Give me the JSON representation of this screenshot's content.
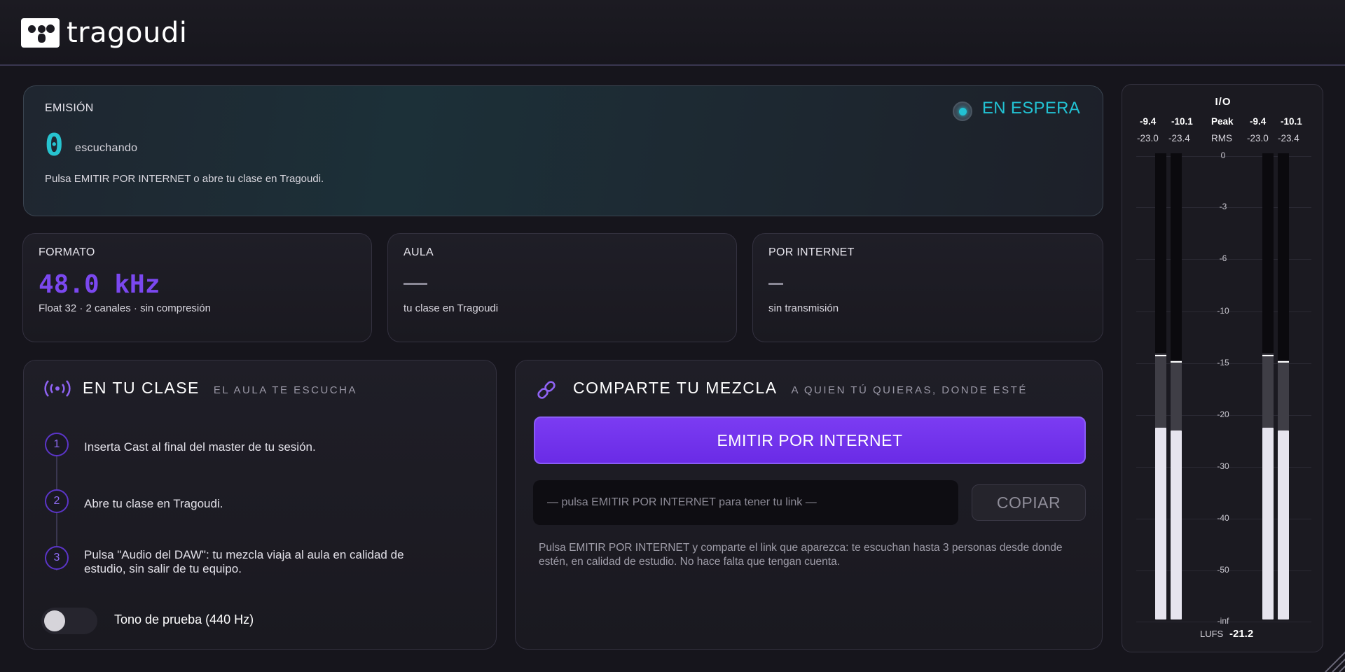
{
  "app": {
    "brand": "tragoudi"
  },
  "emision": {
    "label": "EMISIÓN",
    "count": "0",
    "count_label": "escuchando",
    "hint": "Pulsa EMITIR POR INTERNET o abre tu clase en Tragoudi.",
    "status": "EN ESPERA",
    "status_color": "#22c2d3"
  },
  "stats": {
    "formato": {
      "label": "FORMATO",
      "value": "48.0 kHz",
      "sub": "Float 32 · 2 canales · sin compresión"
    },
    "aula": {
      "label": "AULA",
      "value": "—",
      "sub": "tu clase en Tragoudi"
    },
    "internet": {
      "label": "POR INTERNET",
      "value": "–",
      "sub": "sin transmisión"
    }
  },
  "clase": {
    "title": "EN TU CLASE",
    "subtitle": "EL AULA TE ESCUCHA",
    "icon": "broadcast-icon",
    "steps": [
      {
        "num": "1",
        "text": "Inserta Cast al final del master de tu sesión."
      },
      {
        "num": "2",
        "text": "Abre tu clase en Tragoudi."
      },
      {
        "num": "3",
        "text": "Pulsa \"Audio del DAW\": tu mezcla viaja al aula en calidad de estudio, sin salir de tu equipo."
      }
    ],
    "test_tone": {
      "label": "Tono de prueba (440 Hz)",
      "enabled": false
    }
  },
  "mezcla": {
    "title": "COMPARTE TU MEZCLA",
    "subtitle": "A QUIEN TÚ QUIERAS, DONDE ESTÉ",
    "icon": "link-icon",
    "emit_label": "EMITIR POR INTERNET",
    "link_placeholder": "— pulsa EMITIR POR INTERNET para tener tu link —",
    "copy_label": "COPIAR",
    "note": "Pulsa EMITIR POR INTERNET y comparte el link que aparezca: te escuchan hasta 3 personas desde donde estén, en calidad de estudio. No hace falta que tengan cuenta.",
    "accent": "#7b3cf2"
  },
  "meter": {
    "title": "I/O",
    "peak_label": "Peak",
    "rms_label": "RMS",
    "input": {
      "peak": [
        "-9.4",
        "-10.1"
      ],
      "rms": [
        "-23.0",
        "-23.4"
      ]
    },
    "output": {
      "peak": [
        "-9.4",
        "-10.1"
      ],
      "rms": [
        "-23.0",
        "-23.4"
      ]
    },
    "scale": [
      "0",
      "-3",
      "-6",
      "-10",
      "-15",
      "-20",
      "-30",
      "-40",
      "-50",
      "-inf"
    ],
    "lufs_label": "LUFS",
    "lufs_value": "-21.2",
    "levels_fraction": {
      "peak_hold": [
        0.567,
        0.554
      ],
      "peak_fill": [
        0.57,
        0.555
      ],
      "rms_fill": [
        0.412,
        0.406
      ]
    }
  }
}
